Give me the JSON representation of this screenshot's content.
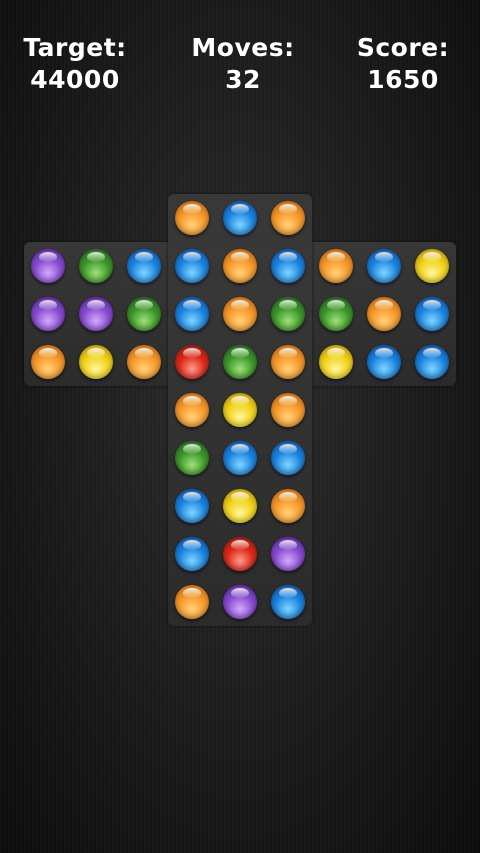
{
  "hud": {
    "target_label": "Target:",
    "target_value": "44000",
    "moves_label": "Moves:",
    "moves_value": "32",
    "score_label": "Score:",
    "score_value": "1650"
  },
  "colors": {
    "orange": "#f59a2c",
    "blue": "#1e86e0",
    "purple": "#8a4fd0",
    "green": "#3d9a2c",
    "yellow": "#f2d41a",
    "red": "#dd2a1a"
  },
  "board": {
    "columns": 9,
    "rows": 9,
    "grid": [
      [
        null,
        null,
        null,
        "orange",
        "blue",
        "orange",
        null,
        null,
        null
      ],
      [
        "purple",
        "green",
        "blue",
        "blue",
        "orange",
        "blue",
        "orange",
        "blue",
        "yellow"
      ],
      [
        "purple",
        "purple",
        "green",
        "blue",
        "orange",
        "green",
        "green",
        "orange",
        "blue"
      ],
      [
        "orange",
        "yellow",
        "orange",
        "red",
        "green",
        "orange",
        "yellow",
        "blue",
        "blue"
      ],
      [
        null,
        null,
        null,
        "orange",
        "yellow",
        "orange",
        null,
        null,
        null
      ],
      [
        null,
        null,
        null,
        "green",
        "blue",
        "blue",
        null,
        null,
        null
      ],
      [
        null,
        null,
        null,
        "blue",
        "yellow",
        "orange",
        null,
        null,
        null
      ],
      [
        null,
        null,
        null,
        "blue",
        "red",
        "purple",
        null,
        null,
        null
      ],
      [
        null,
        null,
        null,
        "orange",
        "purple",
        "blue",
        null,
        null,
        null
      ]
    ]
  }
}
